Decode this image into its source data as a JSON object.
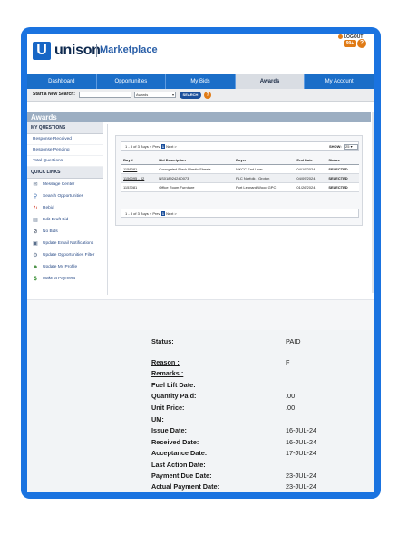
{
  "app": {
    "brand": "unison",
    "brand_logo_letter": "U",
    "product": "Marketplace",
    "logout": "LOGOUT",
    "notification_count": "99+",
    "help": "?"
  },
  "nav": {
    "tabs": [
      {
        "label": "Dashboard"
      },
      {
        "label": "Opportunities"
      },
      {
        "label": "My Bids"
      },
      {
        "label": "Awards"
      },
      {
        "label": "My Account"
      }
    ]
  },
  "search": {
    "label": "Start a New Search:",
    "scope_selected": "Awards",
    "button": "SEARCH",
    "help": "?"
  },
  "section": {
    "title": "Awards"
  },
  "sidebar": {
    "my_questions_heading": "MY QUESTIONS",
    "questions": [
      {
        "label": "Response Received"
      },
      {
        "label": "Response Pending"
      },
      {
        "label": "Total Questions"
      }
    ],
    "quick_links_heading": "QUICK LINKS",
    "quick_links": [
      {
        "label": "Message Center",
        "icon": "envelope-icon"
      },
      {
        "label": "Search Opportunities",
        "icon": "magnifier-icon"
      },
      {
        "label": "Rebid",
        "icon": "rebid-icon"
      },
      {
        "label": "Edit Draft Bid",
        "icon": "document-icon"
      },
      {
        "label": "No Bids",
        "icon": "no-bid-icon"
      },
      {
        "label": "Update Email Notifications",
        "icon": "email-settings-icon"
      },
      {
        "label": "Update Opportunities Filter",
        "icon": "filter-gear-icon"
      },
      {
        "label": "Update My Profile",
        "icon": "profile-icon"
      },
      {
        "label": "Make a Payment",
        "icon": "dollar-icon"
      }
    ]
  },
  "awards": {
    "pager": {
      "text": "1 - 3 of 3 Buys",
      "prev": "< Prev",
      "current_page": "1",
      "next": "Next >",
      "show_label": "SHOW:",
      "show_value": "25"
    },
    "columns": [
      "Buy #",
      "Bid Description",
      "Buyer",
      "End Date",
      "Status"
    ],
    "rows": [
      {
        "buy": "1158081",
        "description": "Corrugated Black Plastic Sheets",
        "buyer": "MKCC End User",
        "end_date": "04/19/2024",
        "status": "SELECTED"
      },
      {
        "buy": "1156095 - 02",
        "description": "NS01892424Q073",
        "buyer": "FLC Norfolk - Groton",
        "end_date": "04/09/2024",
        "status": "SELECTED"
      },
      {
        "buy": "1153081",
        "description": "Office Room Furniture",
        "buyer": "Fort Leonard Wood GPC",
        "end_date": "01/26/2024",
        "status": "SELECTED"
      }
    ]
  },
  "detail": {
    "fields": [
      {
        "label": "Status:",
        "value": "PAID"
      },
      {
        "label": "Reason :",
        "value": "F"
      },
      {
        "label": "Remarks :",
        "value": ""
      },
      {
        "label": "Fuel Lift Date:",
        "value": ""
      },
      {
        "label": "Quantity Paid:",
        "value": ".00"
      },
      {
        "label": "Unit Price:",
        "value": ".00"
      },
      {
        "label": "UM:",
        "value": ""
      },
      {
        "label": "Issue Date:",
        "value": "16-JUL-24"
      },
      {
        "label": "Received Date:",
        "value": "16-JUL-24"
      },
      {
        "label": "Acceptance Date:",
        "value": "17-JUL-24"
      },
      {
        "label": "Last Action Date:",
        "value": ""
      },
      {
        "label": "Payment Due Date:",
        "value": "23-JUL-24"
      },
      {
        "label": "Actual Payment Date:",
        "value": "23-JUL-24"
      }
    ]
  },
  "colors": {
    "frame": "#1a73e0",
    "nav": "#1b6ec8",
    "status_selected": "#d0301c",
    "accent_orange": "#e07b16"
  }
}
